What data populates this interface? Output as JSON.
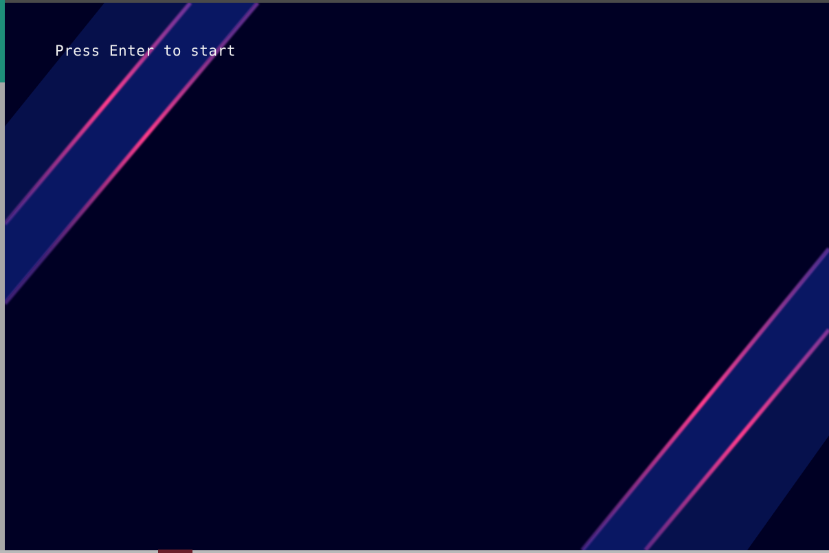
{
  "game": {
    "prompt": "Press Enter to start"
  },
  "colors": {
    "background": "#000024",
    "band": "#0a1557",
    "neon_stripe": "#ff3c8c",
    "edge_stripe": "#6a3aa8"
  }
}
